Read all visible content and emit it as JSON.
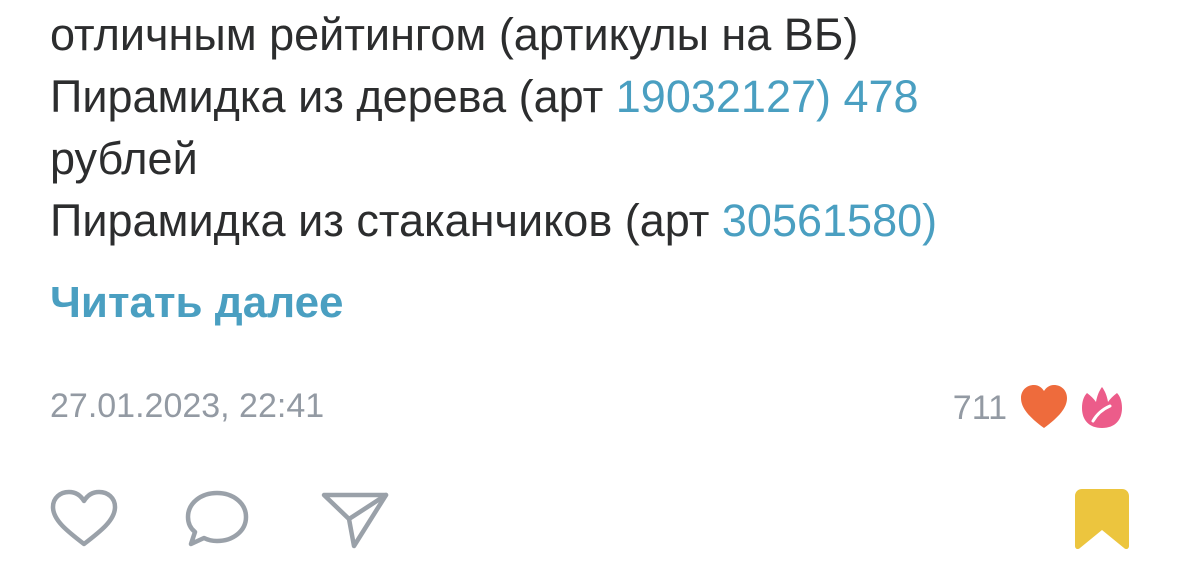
{
  "post": {
    "lines": [
      {
        "parts": [
          "отличным рейтингом (артикулы на ВБ)"
        ]
      },
      {
        "parts": [
          "Пирамидка из дерева (арт ",
          "19032127) 478"
        ]
      },
      {
        "parts": [
          "рублей"
        ]
      },
      {
        "parts": [
          "Пирамидка из стаканчиков (арт ",
          "30561580)"
        ]
      }
    ],
    "read_more_label": "Читать далее"
  },
  "meta": {
    "timestamp": "27.01.2023, 22:41",
    "reactions_count": "711",
    "reaction_icons": [
      "heart-icon",
      "tulip-icon"
    ]
  },
  "actions": {
    "icons": [
      "heart-outline-icon",
      "comment-bubble-icon",
      "share-arrow-icon",
      "bookmark-icon"
    ]
  },
  "colors": {
    "text": "#2c2d2e",
    "link": "#4a9fc1",
    "secondary": "#939aa3",
    "icon_gray": "#9aa1a9",
    "heart_reaction": "#ee6b3c",
    "tulip_reaction": "#ec5c8a",
    "bookmark": "#ecc53e"
  }
}
